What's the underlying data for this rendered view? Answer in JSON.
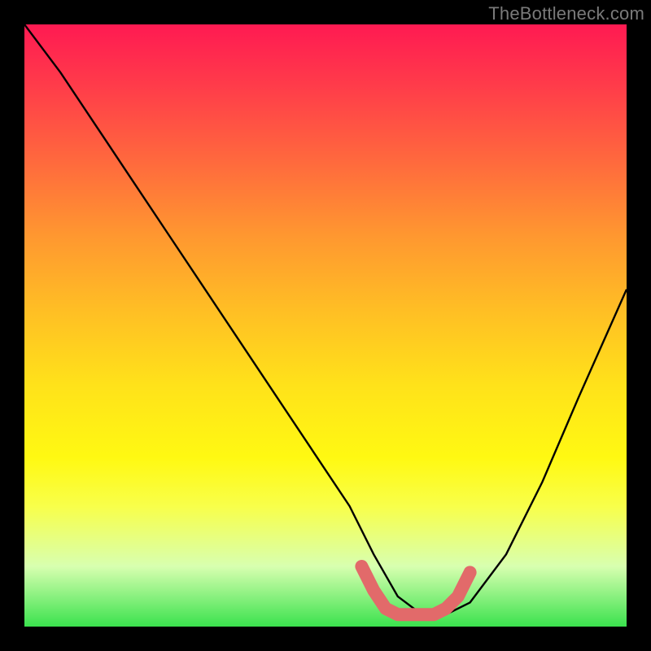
{
  "watermark": "TheBottleneck.com",
  "chart_data": {
    "type": "line",
    "title": "",
    "xlabel": "",
    "ylabel": "",
    "xlim": [
      0,
      100
    ],
    "ylim": [
      0,
      100
    ],
    "grid": false,
    "series": [
      {
        "name": "bottleneck-curve",
        "color": "#000000",
        "x": [
          0,
          6,
          12,
          18,
          24,
          30,
          36,
          42,
          48,
          54,
          58,
          62,
          66,
          70,
          74,
          80,
          86,
          92,
          100
        ],
        "values": [
          100,
          92,
          83,
          74,
          65,
          56,
          47,
          38,
          29,
          20,
          12,
          5,
          2,
          2,
          4,
          12,
          24,
          38,
          56
        ]
      },
      {
        "name": "optimal-band",
        "color": "#e26a6a",
        "x": [
          56,
          58,
          60,
          62,
          64,
          66,
          68,
          70,
          72,
          74
        ],
        "values": [
          10,
          6,
          3,
          2,
          2,
          2,
          2,
          3,
          5,
          9
        ]
      }
    ],
    "background_gradient": {
      "top": "#ff1a52",
      "mid": "#ffe21a",
      "bottom": "#3be24e"
    }
  }
}
